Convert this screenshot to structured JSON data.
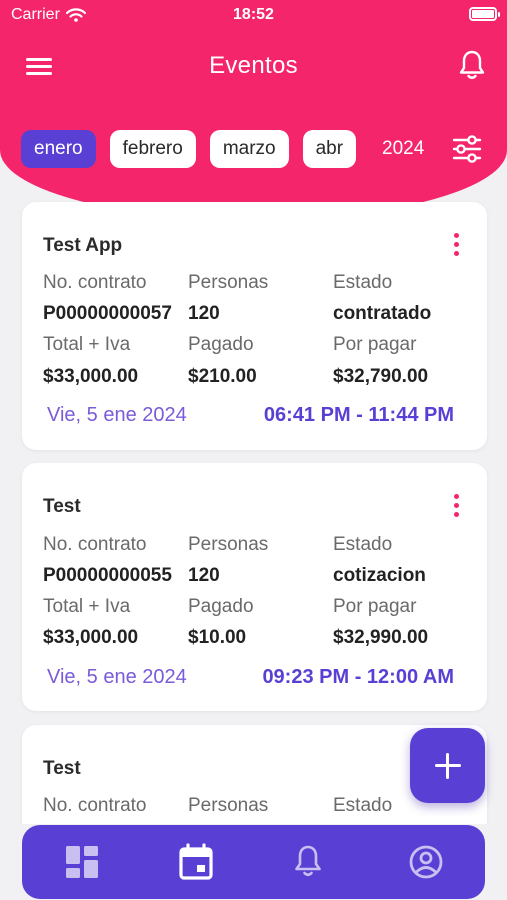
{
  "status_bar": {
    "carrier": "Carrier",
    "time": "18:52"
  },
  "appbar": {
    "title": "Eventos"
  },
  "filters": {
    "months": [
      "enero",
      "febrero",
      "marzo",
      "abr"
    ],
    "selected_month": "enero",
    "year": "2024"
  },
  "labels": {
    "contract": "No. contrato",
    "people": "Personas",
    "status": "Estado",
    "total": "Total + Iva",
    "paid": "Pagado",
    "due": "Por pagar"
  },
  "events": [
    {
      "name": "Test App",
      "contract": "P00000000057",
      "people": "120",
      "status": "contratado",
      "total": "$33,000.00",
      "paid": "$210.00",
      "due": "$32,790.00",
      "date": "Vie, 5 ene 2024",
      "hours": "06:41 PM - 11:44 PM"
    },
    {
      "name": "Test",
      "contract": "P00000000055",
      "people": "120",
      "status": "cotizacion",
      "total": "$33,000.00",
      "paid": "$10.00",
      "due": "$32,990.00",
      "date": "Vie, 5 ene 2024",
      "hours": "09:23 PM - 12:00 AM"
    },
    {
      "name": "Test"
    }
  ],
  "colors": {
    "header": "#f5256c",
    "accent": "#5a3fd4",
    "date_text": "#7a5bd8"
  },
  "icons": {
    "menu": "hamburger-menu-icon",
    "notifications": "bell-icon",
    "filter": "sliders-icon",
    "card_menu": "more-vertical-icon",
    "fab": "plus-icon",
    "nav": [
      "dashboard-icon",
      "calendar-icon",
      "bell-icon",
      "account-icon"
    ]
  }
}
